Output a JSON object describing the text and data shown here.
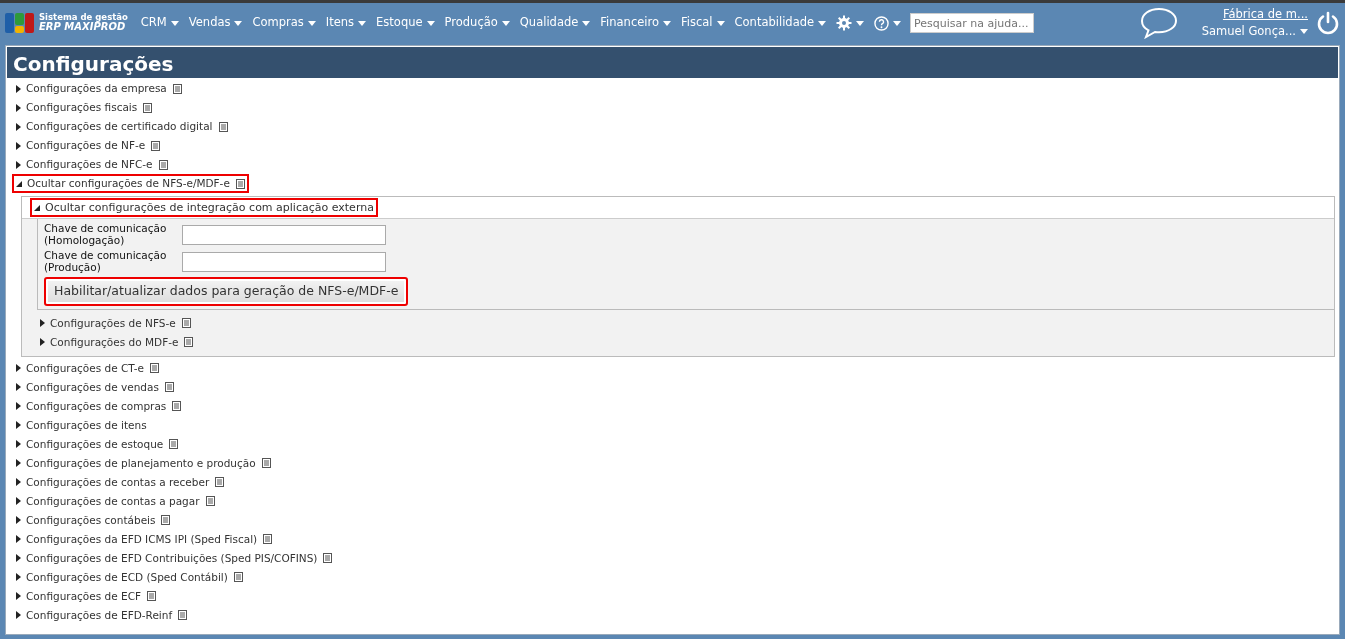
{
  "nav": {
    "logo": {
      "line1": "Sistema de gestão",
      "line2": "ERP MAXIPROD"
    },
    "menus": [
      {
        "label": "CRM"
      },
      {
        "label": "Vendas"
      },
      {
        "label": "Compras"
      },
      {
        "label": "Itens"
      },
      {
        "label": "Estoque"
      },
      {
        "label": "Produção"
      },
      {
        "label": "Qualidade"
      },
      {
        "label": "Financeiro"
      },
      {
        "label": "Fiscal"
      },
      {
        "label": "Contabilidade"
      }
    ],
    "search": {
      "placeholder": "Pesquisar na ajuda..."
    },
    "company": "Fábrica de m...",
    "user": "Samuel Gonça..."
  },
  "page_title": "Configurações",
  "sections": [
    {
      "label": "Configurações da empresa",
      "expanded": false,
      "doc": true,
      "highlighted": false
    },
    {
      "label": "Configurações fiscais",
      "expanded": false,
      "doc": true,
      "highlighted": false
    },
    {
      "label": "Configurações de certificado digital",
      "expanded": false,
      "doc": true,
      "highlighted": false
    },
    {
      "label": "Configurações de NF-e",
      "expanded": false,
      "doc": true,
      "highlighted": false
    },
    {
      "label": "Configurações de NFC-e",
      "expanded": false,
      "doc": true,
      "highlighted": false
    },
    {
      "label": "Ocultar configurações de NFS-e/MDF-e",
      "expanded": true,
      "doc": true,
      "highlighted": true,
      "panel": {
        "integration": {
          "label": "Ocultar configurações de integração com aplicação externa",
          "expanded": true,
          "highlighted": true,
          "fields": [
            {
              "label": "Chave de comunicação (Homologação)"
            },
            {
              "label": "Chave de comunicação (Produção)"
            }
          ],
          "button": {
            "label": "Habilitar/atualizar dados para geração de NFS-e/MDF-e",
            "highlighted": true
          }
        },
        "items": [
          {
            "label": "Configurações de NFS-e",
            "expanded": false,
            "doc": true
          },
          {
            "label": "Configurações do MDF-e",
            "expanded": false,
            "doc": true
          }
        ]
      }
    },
    {
      "label": "Configurações de CT-e",
      "expanded": false,
      "doc": true,
      "highlighted": false
    },
    {
      "label": "Configurações de vendas",
      "expanded": false,
      "doc": true,
      "highlighted": false
    },
    {
      "label": "Configurações de compras",
      "expanded": false,
      "doc": true,
      "highlighted": false
    },
    {
      "label": "Configurações de itens",
      "expanded": false,
      "doc": false,
      "highlighted": false
    },
    {
      "label": "Configurações de estoque",
      "expanded": false,
      "doc": true,
      "highlighted": false
    },
    {
      "label": "Configurações de planejamento e produção",
      "expanded": false,
      "doc": true,
      "highlighted": false
    },
    {
      "label": "Configurações de contas a receber",
      "expanded": false,
      "doc": true,
      "highlighted": false
    },
    {
      "label": "Configurações de contas a pagar",
      "expanded": false,
      "doc": true,
      "highlighted": false
    },
    {
      "label": "Configurações contábeis",
      "expanded": false,
      "doc": true,
      "highlighted": false
    },
    {
      "label": "Configurações da EFD ICMS IPI (Sped Fiscal)",
      "expanded": false,
      "doc": true,
      "highlighted": false
    },
    {
      "label": "Configurações de EFD Contribuições (Sped PIS/COFINS)",
      "expanded": false,
      "doc": true,
      "highlighted": false
    },
    {
      "label": "Configurações de ECD (Sped Contábil)",
      "expanded": false,
      "doc": true,
      "highlighted": false
    },
    {
      "label": "Configurações de ECF",
      "expanded": false,
      "doc": true,
      "highlighted": false
    },
    {
      "label": "Configurações de EFD-Reinf",
      "expanded": false,
      "doc": true,
      "highlighted": false
    }
  ]
}
